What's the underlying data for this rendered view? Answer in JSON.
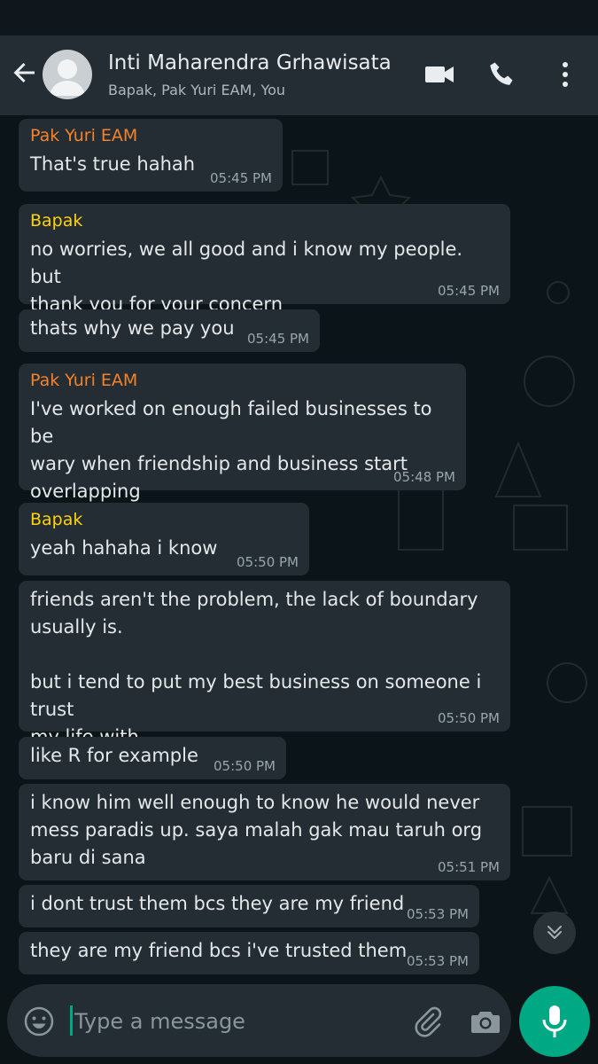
{
  "header": {
    "title": "Inti Maharendra Grhawisata",
    "subtitle": "Bapak, Pak Yuri EAM, You"
  },
  "icons": {
    "back": "arrow-left",
    "avatar": "group-avatar",
    "video": "video-camera",
    "call": "phone",
    "menu": "more-vertical",
    "scroll_down": "double-chevron-down",
    "emoji": "smiley",
    "attach": "paperclip",
    "camera": "camera",
    "mic": "microphone"
  },
  "colors": {
    "accent": "#00a884",
    "sender_yuri": "#f5822b",
    "sender_bapak": "#ffd20a",
    "bubble": "#232d33"
  },
  "messages": [
    {
      "sender": "Pak Yuri EAM",
      "text": "That's true hahah",
      "time": "05:45 PM"
    },
    {
      "sender": "Bapak",
      "text": "no worries, we all good and i know my people. but\nthank you for your concern",
      "time": "05:45 PM"
    },
    {
      "sender": "",
      "text": "thats why we pay you",
      "time": "05:45 PM"
    },
    {
      "sender": "Pak Yuri EAM",
      "text": "I've worked on enough failed businesses to be\nwary when friendship and business start\noverlapping",
      "time": "05:48 PM"
    },
    {
      "sender": "Bapak",
      "text": "yeah hahaha i know",
      "time": "05:50 PM"
    },
    {
      "sender": "",
      "text": "friends aren't the problem, the lack of boundary\nusually is.\n\nbut i tend to put my best business on someone i trust\nmy life with",
      "time": "05:50 PM"
    },
    {
      "sender": "",
      "text": "like R for example",
      "time": "05:50 PM"
    },
    {
      "sender": "",
      "text": "i know him well enough to know he would never\nmess paradis up. saya malah gak mau taruh org\nbaru di sana",
      "time": "05:51 PM"
    },
    {
      "sender": "",
      "text": "i dont trust them bcs they are my friend",
      "time": "05:53 PM"
    },
    {
      "sender": "",
      "text": "they are my friend bcs i've trusted them",
      "time": "05:53 PM"
    }
  ],
  "composer": {
    "placeholder": "Type a message"
  }
}
